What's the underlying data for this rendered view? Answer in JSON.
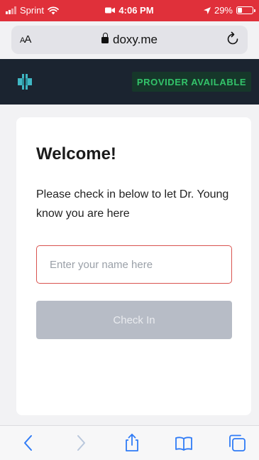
{
  "status_bar": {
    "carrier": "Sprint",
    "time": "4:06 PM",
    "battery_percent": "29%",
    "battery_level": 0.29
  },
  "browser": {
    "text_size_label": "AA",
    "domain": "doxy.me",
    "icons": [
      "lock-icon",
      "reload-icon",
      "back-icon",
      "forward-icon",
      "share-icon",
      "bookmarks-icon",
      "tabs-icon"
    ]
  },
  "header": {
    "status_badge": "PROVIDER AVAILABLE",
    "badge_color": "#33c46a"
  },
  "checkin": {
    "title": "Welcome!",
    "message": "Please check in below to let Dr. Young know you are here",
    "name_placeholder": "Enter your name here",
    "name_value": "",
    "button_label": "Check In"
  }
}
